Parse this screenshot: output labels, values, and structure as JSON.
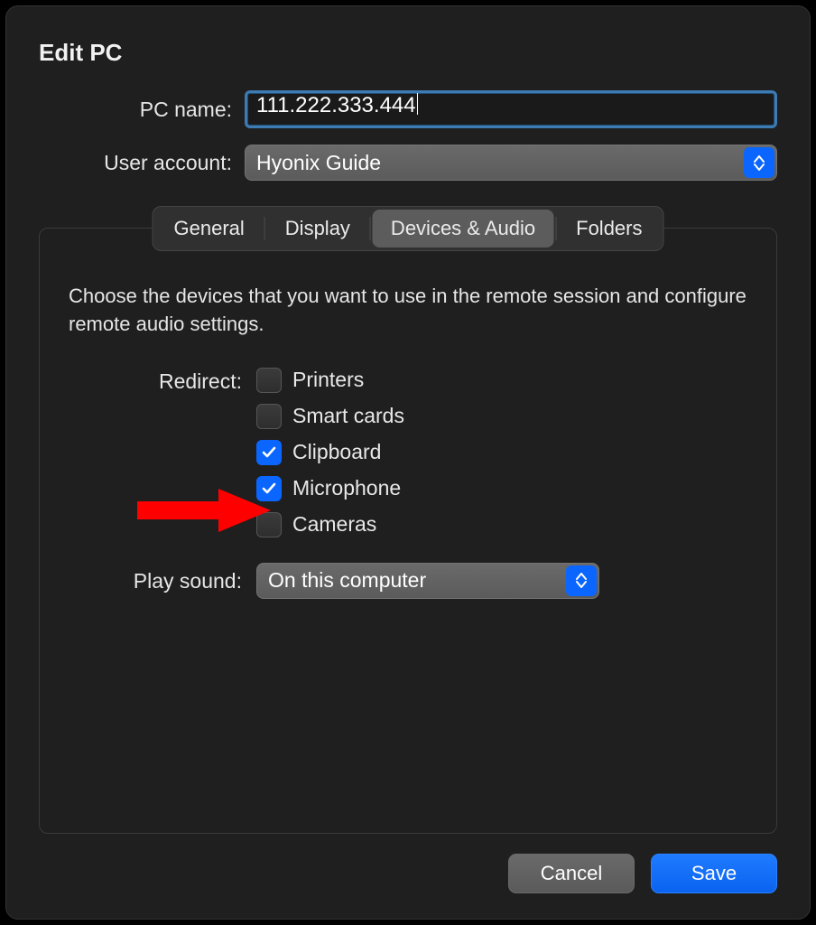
{
  "window": {
    "title": "Edit PC"
  },
  "form": {
    "pc_name_label": "PC name:",
    "pc_name_value": "111.222.333.444",
    "user_account_label": "User account:",
    "user_account_value": "Hyonix Guide"
  },
  "tabs": {
    "general": "General",
    "display": "Display",
    "devices_audio": "Devices & Audio",
    "folders": "Folders",
    "active": "devices_audio"
  },
  "panel": {
    "description": "Choose the devices that you want to use in the remote session and configure remote audio settings.",
    "redirect_label": "Redirect:",
    "redirect": {
      "printers": {
        "label": "Printers",
        "checked": false
      },
      "smartcards": {
        "label": "Smart cards",
        "checked": false
      },
      "clipboard": {
        "label": "Clipboard",
        "checked": true
      },
      "microphone": {
        "label": "Microphone",
        "checked": true
      },
      "cameras": {
        "label": "Cameras",
        "checked": false
      }
    },
    "play_sound_label": "Play sound:",
    "play_sound_value": "On this computer"
  },
  "footer": {
    "cancel": "Cancel",
    "save": "Save"
  },
  "annotation": {
    "arrow_target": "microphone-checkbox"
  }
}
